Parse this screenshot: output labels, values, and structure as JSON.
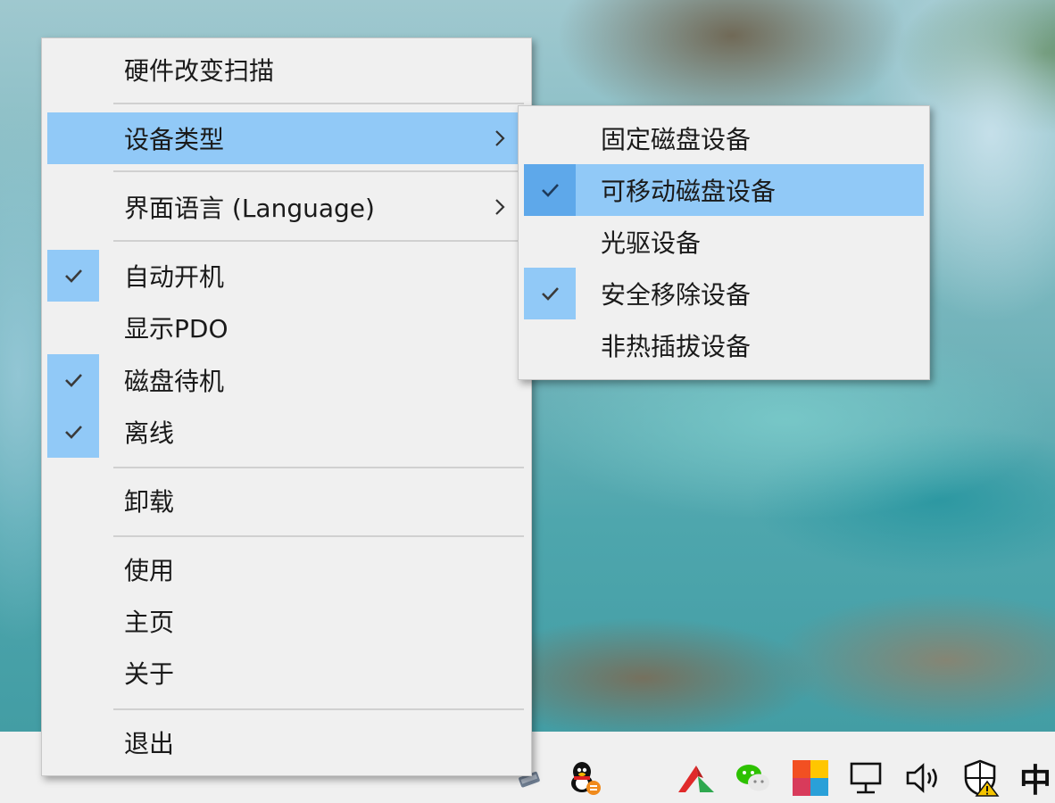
{
  "main_menu": {
    "items": [
      {
        "label": "硬件改变扫描",
        "checked": false,
        "submenu": false
      },
      {
        "label": "设备类型",
        "checked": false,
        "submenu": true,
        "highlighted": true
      },
      {
        "label": "界面语言 (Language)",
        "checked": false,
        "submenu": true
      },
      {
        "label": "自动开机",
        "checked": true
      },
      {
        "label": "显示PDO",
        "checked": false
      },
      {
        "label": "磁盘待机",
        "checked": true
      },
      {
        "label": "离线",
        "checked": true
      },
      {
        "label": "卸载",
        "checked": false
      },
      {
        "label": "使用",
        "checked": false
      },
      {
        "label": "主页",
        "checked": false
      },
      {
        "label": "关于",
        "checked": false
      },
      {
        "label": "退出",
        "checked": false
      }
    ]
  },
  "sub_menu": {
    "items": [
      {
        "label": "固定磁盘设备",
        "checked": false
      },
      {
        "label": "可移动磁盘设备",
        "checked": true,
        "highlighted": true
      },
      {
        "label": "光驱设备",
        "checked": false
      },
      {
        "label": "安全移除设备",
        "checked": true
      },
      {
        "label": "非热插拔设备",
        "checked": false
      }
    ]
  },
  "taskbar": {
    "ime_label": "中",
    "icons": [
      "usb-device-icon",
      "qq-icon",
      "red-app-icon",
      "wechat-icon",
      "color-grid-icon",
      "network-icon",
      "volume-icon",
      "security-warning-icon"
    ]
  },
  "colors": {
    "highlight": "#91c9f7",
    "check_on_highlight": "#5ea8ea",
    "menu_bg": "#f0f0f0"
  }
}
